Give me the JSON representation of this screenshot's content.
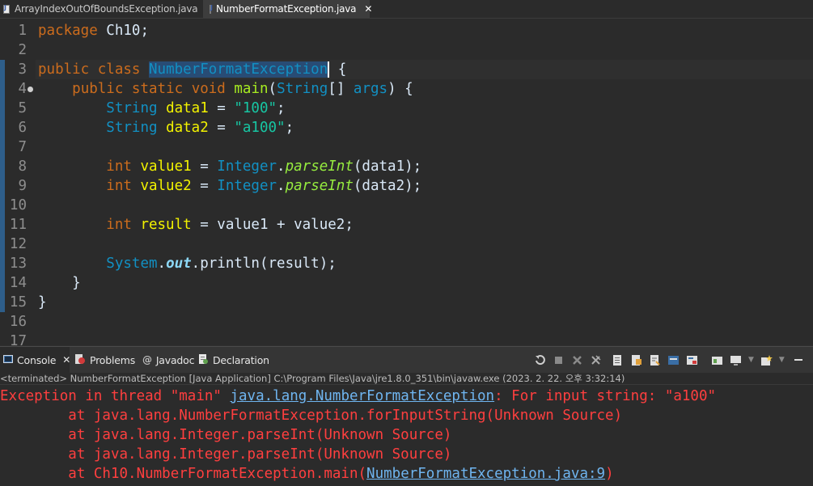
{
  "editor_tabs": [
    {
      "label": "ArrayIndexOutOfBoundsException.java",
      "active": false
    },
    {
      "label": "NumberFormatException.java",
      "active": true,
      "close": "✕"
    }
  ],
  "line_numbers": [
    "1",
    "2",
    "3",
    "4",
    "5",
    "6",
    "7",
    "8",
    "9",
    "10",
    "11",
    "12",
    "13",
    "14",
    "15",
    "16",
    "17"
  ],
  "code": {
    "line1": {
      "kw": "package",
      "rest": " Ch10;"
    },
    "line3": {
      "kw1": "public",
      "kw2": "class",
      "classname": "NumberFormatException",
      "rest": " {"
    },
    "line4": {
      "kw1": "public",
      "kw2": "static",
      "kw3": "void",
      "method": "main",
      "p1": "(",
      "type": "String",
      "p2": "[] ",
      "param": "args",
      "p3": ") {"
    },
    "line5": {
      "type": "String",
      "var": "data1",
      "eq": " = ",
      "str": "\"100\"",
      "end": ";"
    },
    "line6": {
      "type": "String",
      "var": "data2",
      "eq": " = ",
      "str": "\"a100\"",
      "end": ";"
    },
    "line8": {
      "type": "int",
      "var": "value1",
      "eq": " = ",
      "cls": "Integer",
      "dot": ".",
      "meth": "parseInt",
      "args": "(data1);"
    },
    "line9": {
      "type": "int",
      "var": "value2",
      "eq": " = ",
      "cls": "Integer",
      "dot": ".",
      "meth": "parseInt",
      "args": "(data2);"
    },
    "line11": {
      "type": "int",
      "var": "result",
      "rest": " = value1 + value2;"
    },
    "line13": {
      "cls": "System",
      "dot": ".",
      "field": "out",
      "rest": ".println(result);"
    },
    "line14": {
      "rest": "}"
    },
    "line15": {
      "rest": "}"
    }
  },
  "console_tabs": [
    {
      "label": "Console",
      "close": "✕"
    },
    {
      "label": "Problems"
    },
    {
      "label": "Javadoc"
    },
    {
      "label": "Declaration"
    }
  ],
  "status_line": "<terminated> NumberFormatException [Java Application] C:\\Program Files\\Java\\jre1.8.0_351\\bin\\javaw.exe (2023. 2. 22. 오후 3:32:14)",
  "console_output": {
    "line1": {
      "pre": "Exception in thread \"main\" ",
      "link": "java.lang.NumberFormatException",
      "post": ": For input string: \"a100\""
    },
    "line2": "\tat java.lang.NumberFormatException.forInputString(Unknown Source)",
    "line3": "\tat java.lang.Integer.parseInt(Unknown Source)",
    "line4": "\tat java.lang.Integer.parseInt(Unknown Source)",
    "line5": {
      "pre": "\tat Ch10.NumberFormatException.main(",
      "link": "NumberFormatException.java:9",
      "post": ")"
    }
  },
  "colors": {
    "keyword": "#cc6c1d",
    "class": "#1290c3",
    "variable": "#f2f200",
    "string": "#17c6a3",
    "method": "#a7ec21",
    "error": "#ff3f3f"
  }
}
